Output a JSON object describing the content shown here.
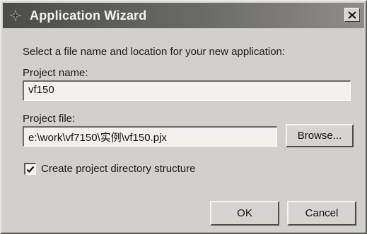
{
  "window": {
    "title": "Application Wizard"
  },
  "instruction": "Select a file name and location for your new application:",
  "project_name": {
    "label": "Project name:",
    "value": "vf150"
  },
  "project_file": {
    "label": "Project file:",
    "value": "e:\\work\\vf7150\\实例\\vf150.pjx",
    "browse_label": "Browse..."
  },
  "create_directory": {
    "label": "Create project directory structure",
    "checked": true
  },
  "buttons": {
    "ok_label": "OK",
    "cancel_label": "Cancel"
  },
  "icons": {
    "app": "wizard-icon",
    "close": "close-icon",
    "check": "checkmark-icon"
  }
}
